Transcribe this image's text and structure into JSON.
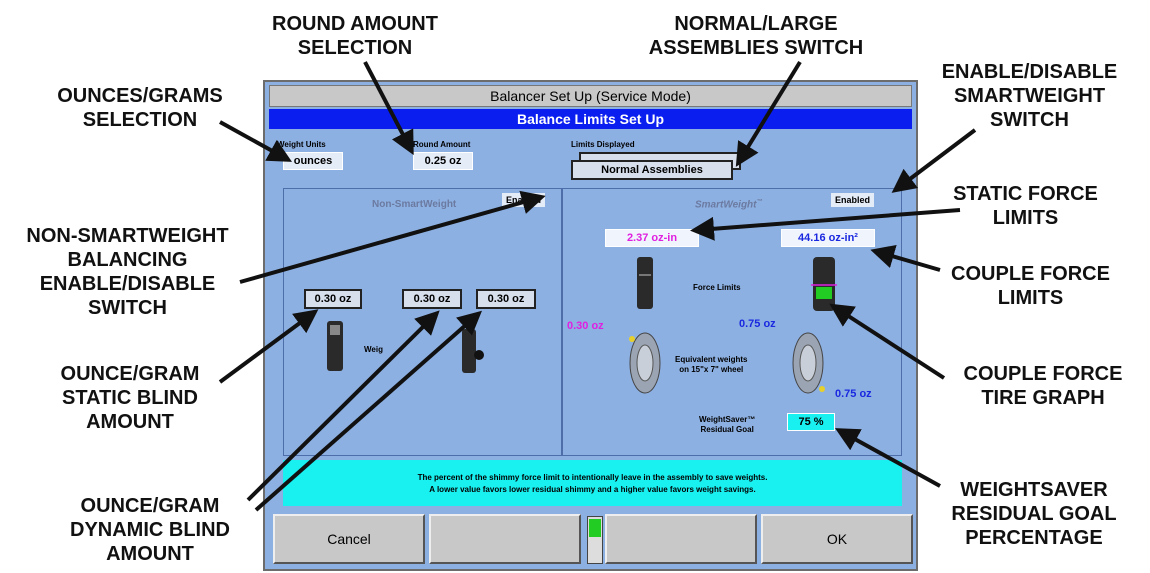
{
  "callouts": {
    "ounces_grams": [
      "OUNCES/GRAMS",
      "SELECTION"
    ],
    "round_amount": [
      "ROUND AMOUNT",
      "SELECTION"
    ],
    "normal_large": [
      "NORMAL/LARGE",
      "ASSEMBLIES SWITCH"
    ],
    "enable_smartweight": [
      "ENABLE/DISABLE",
      "SMARTWEIGHT",
      "SWITCH"
    ],
    "static_force": [
      "STATIC FORCE",
      "LIMITS"
    ],
    "couple_force_limits": [
      "COUPLE FORCE",
      "LIMITS"
    ],
    "non_smartweight": [
      "NON-SMARTWEIGHT",
      "BALANCING",
      "ENABLE/DISABLE",
      "SWITCH"
    ],
    "static_blind": [
      "OUNCE/GRAM",
      "STATIC BLIND",
      "AMOUNT"
    ],
    "couple_graph": [
      "COUPLE FORCE",
      "TIRE GRAPH"
    ],
    "dynamic_blind": [
      "OUNCE/GRAM",
      "DYNAMIC BLIND",
      "AMOUNT"
    ],
    "weightsaver": [
      "WEIGHTSAVER",
      "RESIDUAL GOAL",
      "PERCENTAGE"
    ]
  },
  "window": {
    "title": "Balancer Set Up (Service Mode)",
    "subtitle": "Balance Limits Set Up"
  },
  "settings": {
    "weight_units_label": "Weight Units",
    "weight_units_value": "ounces",
    "round_amount_label": "Round Amount",
    "round_amount_value": "0.25 oz",
    "limits_label": "Limits Displayed",
    "limits_value": "Normal Assemblies"
  },
  "non_smartweight": {
    "title": "Non-SmartWeight",
    "status": "Enabled",
    "static_blind": "0.30 oz",
    "dynamic_blind_1": "0.30 oz",
    "dynamic_blind_2": "0.30 oz",
    "weights_label": "Weig"
  },
  "smartweight": {
    "title": "SmartWeight",
    "title_mark": "™",
    "status": "Enabled",
    "static_limit": "2.37 oz-in",
    "couple_limit": "44.16 oz-in²",
    "force_limits_label": "Force Limits",
    "static_weight": "0.30 oz",
    "couple_weight_top": "0.75 oz",
    "couple_weight_bottom": "0.75 oz",
    "equivalent_label": [
      "Equivalent weights",
      "on 15\"x 7\" wheel"
    ],
    "weightsaver_label": [
      "WeightSaver™",
      "Residual Goal"
    ],
    "weightsaver_value": "75 %"
  },
  "info": {
    "line1": "The percent of the shimmy force limit to intentionally leave in the assembly to save weights.",
    "line2": "A lower value favors lower residual shimmy and a higher value favors weight savings."
  },
  "buttons": {
    "cancel": "Cancel",
    "f2": "",
    "f3": "",
    "ok": "OK"
  },
  "colors": {
    "window_bg": "#8db0e2",
    "title_blue": "#0a1ef0",
    "info_cyan": "#19f0f0",
    "static_magenta": "#e020e0",
    "couple_blue": "#1a28e0",
    "indicator_green": "#22cc22"
  }
}
